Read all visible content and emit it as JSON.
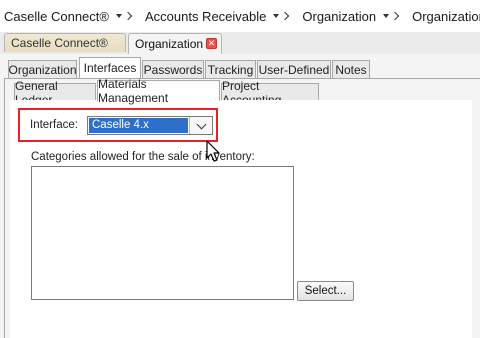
{
  "breadcrumb": {
    "items": [
      "Caselle Connect®",
      "Accounts Receivable",
      "Organization",
      "Organization"
    ]
  },
  "doc_tabs": {
    "inactive": "Caselle Connect®",
    "active": "Organization",
    "close_glyph": "✕"
  },
  "main_tabs": [
    "Organization",
    "Interfaces",
    "Passwords",
    "Tracking",
    "User-Defined",
    "Notes"
  ],
  "sub_tabs": [
    "General Ledger",
    "Materials Management",
    "Project Accounting"
  ],
  "form": {
    "interface_label": "Interface:",
    "interface_value": "Caselle 4.x",
    "categories_label": "Categories allowed for the sale of inventory:",
    "select_button": "Select..."
  },
  "colors": {
    "highlight": "#e8202a",
    "selection": "#2f6fc9",
    "close": "#e0554a"
  },
  "icons": [
    "chevron-down-icon",
    "chevron-right-icon",
    "close-icon",
    "mouse-cursor-icon"
  ]
}
